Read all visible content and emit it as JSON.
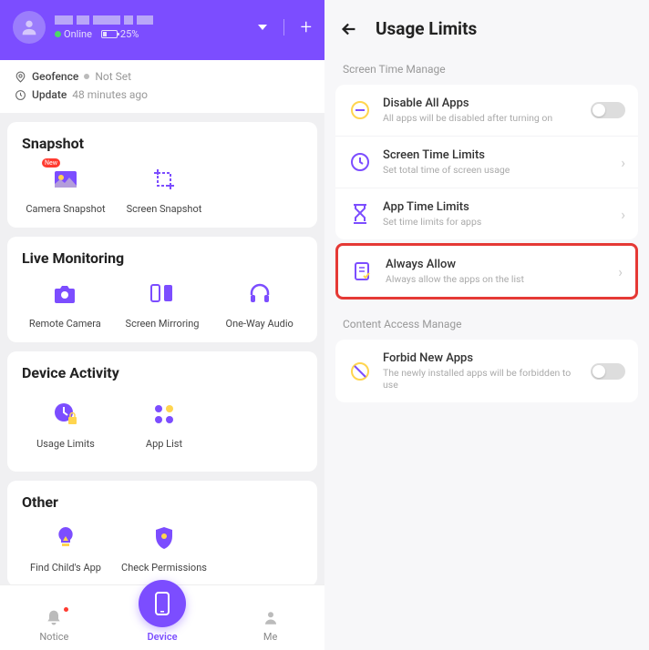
{
  "header": {
    "status": "Online",
    "battery": "25%"
  },
  "info": {
    "geofence_label": "Geofence",
    "geofence_value": "Not Set",
    "update_label": "Update",
    "update_value": "48 minutes ago"
  },
  "sections": {
    "snapshot": {
      "title": "Snapshot",
      "items": [
        "Camera Snapshot",
        "Screen Snapshot"
      ]
    },
    "live": {
      "title": "Live Monitoring",
      "items": [
        "Remote Camera",
        "Screen Mirroring",
        "One-Way Audio"
      ]
    },
    "activity": {
      "title": "Device Activity",
      "items": [
        "Usage Limits",
        "App List"
      ]
    },
    "other": {
      "title": "Other",
      "items": [
        "Find Child's App",
        "Check Permissions"
      ]
    }
  },
  "nav": {
    "notice": "Notice",
    "device": "Device",
    "me": "Me"
  },
  "right": {
    "title": "Usage Limits",
    "screen_manage": "Screen Time Manage",
    "disable_all": {
      "title": "Disable All Apps",
      "sub": "All apps will be disabled after turning on"
    },
    "screen_limits": {
      "title": "Screen Time Limits",
      "sub": "Set total time of screen usage"
    },
    "app_limits": {
      "title": "App Time Limits",
      "sub": "Set time limits for apps"
    },
    "always_allow": {
      "title": "Always Allow",
      "sub": "Always allow the apps on the list"
    },
    "content_manage": "Content Access Manage",
    "forbid_new": {
      "title": "Forbid New Apps",
      "sub": "The newly installed apps will be forbidden to use"
    }
  }
}
